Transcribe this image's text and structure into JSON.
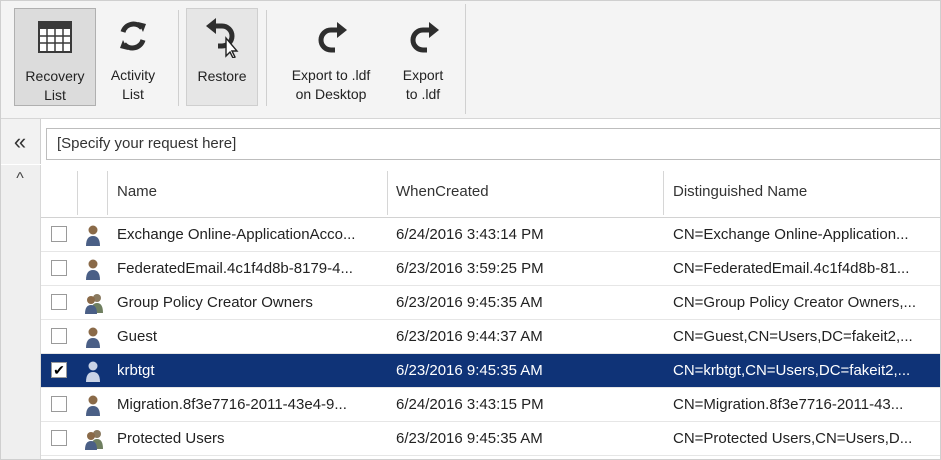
{
  "ribbon": {
    "buttons": [
      {
        "label_line1": "Recovery",
        "label_line2": "List",
        "icon": "grid-list-icon",
        "state": "active"
      },
      {
        "label_line1": "Activity",
        "label_line2": "List",
        "icon": "refresh-icon",
        "state": "normal"
      },
      {
        "label_line1": "Restore",
        "label_line2": "",
        "icon": "undo-arrow-icon",
        "state": "hover"
      },
      {
        "label_line1": "Export to .ldf",
        "label_line2": "on Desktop",
        "icon": "redo-arrow-icon",
        "state": "normal"
      },
      {
        "label_line1": "Export",
        "label_line2": "to .ldf",
        "icon": "redo-arrow-icon",
        "state": "normal"
      }
    ]
  },
  "request": {
    "placeholder": "[Specify your request here]"
  },
  "collapse_glyph": "«",
  "scroll_up_glyph": "^",
  "grid": {
    "columns": [
      "Name",
      "WhenCreated",
      "Distinguished Name"
    ],
    "rows": [
      {
        "checked": false,
        "icon": "user-icon",
        "name": "Exchange Online-ApplicationAcco...",
        "when": "6/24/2016 3:43:14 PM",
        "dn": "CN=Exchange Online-Application..."
      },
      {
        "checked": false,
        "icon": "user-icon",
        "name": "FederatedEmail.4c1f4d8b-8179-4...",
        "when": "6/23/2016 3:59:25 PM",
        "dn": "CN=FederatedEmail.4c1f4d8b-81..."
      },
      {
        "checked": false,
        "icon": "group-icon",
        "name": "Group Policy Creator Owners",
        "when": "6/23/2016 9:45:35 AM",
        "dn": "CN=Group Policy Creator Owners,..."
      },
      {
        "checked": false,
        "icon": "user-icon",
        "name": "Guest",
        "when": "6/23/2016 9:44:37 AM",
        "dn": "CN=Guest,CN=Users,DC=fakeit2,..."
      },
      {
        "checked": true,
        "icon": "user-icon",
        "name": "krbtgt",
        "when": "6/23/2016 9:45:35 AM",
        "dn": "CN=krbtgt,CN=Users,DC=fakeit2,..."
      },
      {
        "checked": false,
        "icon": "user-icon",
        "name": "Migration.8f3e7716-2011-43e4-9...",
        "when": "6/24/2016 3:43:15 PM",
        "dn": "CN=Migration.8f3e7716-2011-43..."
      },
      {
        "checked": false,
        "icon": "group-icon",
        "name": "Protected Users",
        "when": "6/23/2016 9:45:35 AM",
        "dn": "CN=Protected Users,CN=Users,D..."
      }
    ]
  },
  "colors": {
    "selected_row": "#0f3377",
    "ribbon_bg": "#f4f4f4"
  }
}
